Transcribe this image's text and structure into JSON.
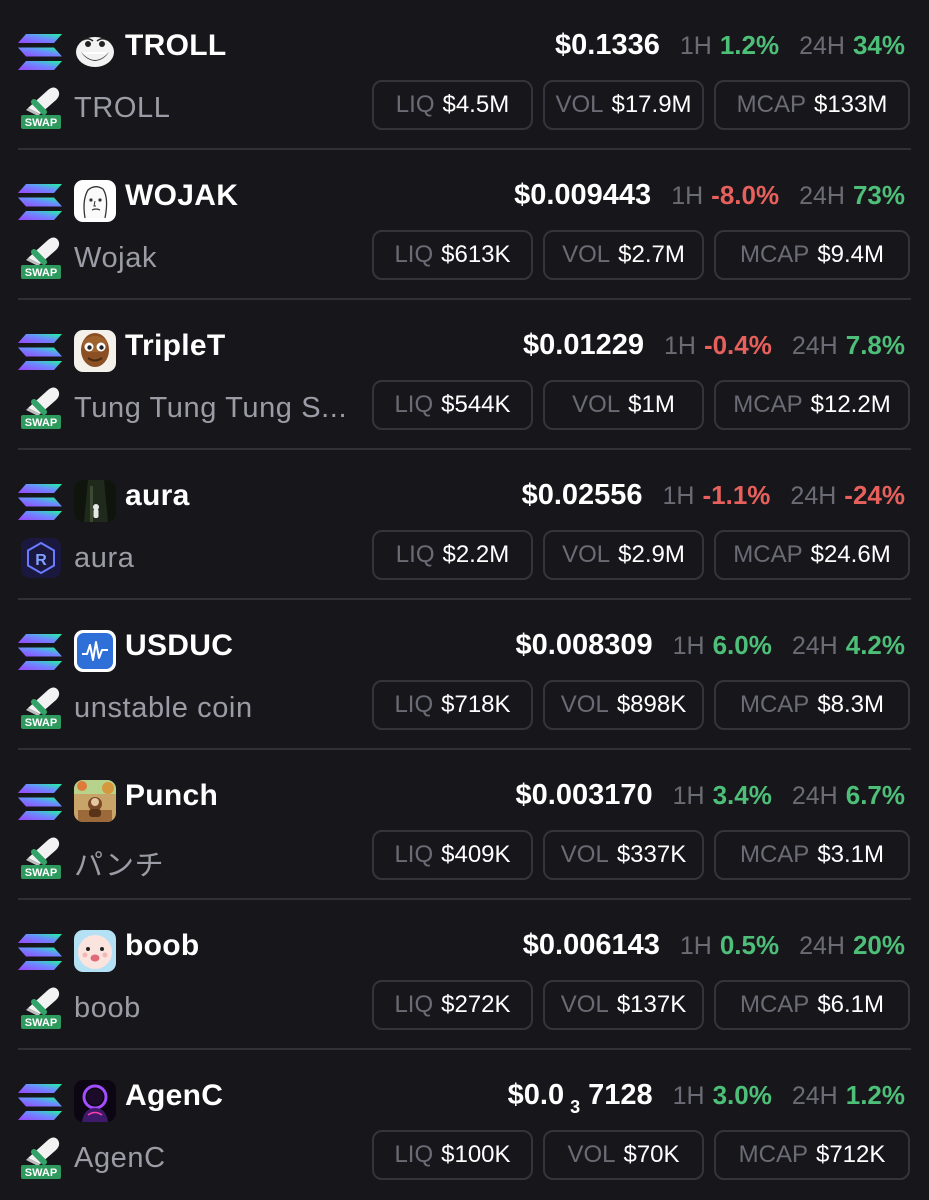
{
  "tokens": [
    {
      "symbol": "TROLL",
      "name": "TROLL",
      "logo": "troll-face-logo",
      "dex": "swap",
      "chain": "solana",
      "price": "$0.1336",
      "price_sub": "",
      "price_tail": "",
      "h1_label": "1H",
      "h1": "1.2%",
      "h1_dir": "pos",
      "h24_label": "24H",
      "h24": "34%",
      "h24_dir": "pos",
      "liq_label": "LIQ",
      "liq": "$4.5M",
      "vol_label": "VOL",
      "vol": "$17.9M",
      "mcap_label": "MCAP",
      "mcap": "$133M"
    },
    {
      "symbol": "WOJAK",
      "name": "Wojak",
      "logo": "wojak-logo",
      "dex": "swap",
      "chain": "solana",
      "price": "$0.009443",
      "price_sub": "",
      "price_tail": "",
      "h1_label": "1H",
      "h1": "-8.0%",
      "h1_dir": "neg",
      "h24_label": "24H",
      "h24": "73%",
      "h24_dir": "pos",
      "liq_label": "LIQ",
      "liq": "$613K",
      "vol_label": "VOL",
      "vol": "$2.7M",
      "mcap_label": "MCAP",
      "mcap": "$9.4M"
    },
    {
      "symbol": "TripleT",
      "name": "Tung Tung Tung S...",
      "logo": "tripleT-logo",
      "dex": "swap",
      "chain": "solana",
      "price": "$0.01229",
      "price_sub": "",
      "price_tail": "",
      "h1_label": "1H",
      "h1": "-0.4%",
      "h1_dir": "neg",
      "h24_label": "24H",
      "h24": "7.8%",
      "h24_dir": "pos",
      "liq_label": "LIQ",
      "liq": "$544K",
      "vol_label": "VOL",
      "vol": "$1M",
      "mcap_label": "MCAP",
      "mcap": "$12.2M"
    },
    {
      "symbol": "aura",
      "name": "aura",
      "logo": "aura-logo",
      "dex": "raydium",
      "chain": "solana",
      "price": "$0.02556",
      "price_sub": "",
      "price_tail": "",
      "h1_label": "1H",
      "h1": "-1.1%",
      "h1_dir": "neg",
      "h24_label": "24H",
      "h24": "-24%",
      "h24_dir": "neg",
      "liq_label": "LIQ",
      "liq": "$2.2M",
      "vol_label": "VOL",
      "vol": "$2.9M",
      "mcap_label": "MCAP",
      "mcap": "$24.6M"
    },
    {
      "symbol": "USDUC",
      "name": "unstable coin",
      "logo": "usduc-logo",
      "dex": "swap",
      "chain": "solana",
      "price": "$0.008309",
      "price_sub": "",
      "price_tail": "",
      "h1_label": "1H",
      "h1": "6.0%",
      "h1_dir": "pos",
      "h24_label": "24H",
      "h24": "4.2%",
      "h24_dir": "pos",
      "liq_label": "LIQ",
      "liq": "$718K",
      "vol_label": "VOL",
      "vol": "$898K",
      "mcap_label": "MCAP",
      "mcap": "$8.3M"
    },
    {
      "symbol": "Punch",
      "name": "パンチ",
      "logo": "punch-logo",
      "dex": "swap",
      "chain": "solana",
      "price": "$0.003170",
      "price_sub": "",
      "price_tail": "",
      "h1_label": "1H",
      "h1": "3.4%",
      "h1_dir": "pos",
      "h24_label": "24H",
      "h24": "6.7%",
      "h24_dir": "pos",
      "liq_label": "LIQ",
      "liq": "$409K",
      "vol_label": "VOL",
      "vol": "$337K",
      "mcap_label": "MCAP",
      "mcap": "$3.1M"
    },
    {
      "symbol": "boob",
      "name": "boob",
      "logo": "boob-logo",
      "dex": "swap",
      "chain": "solana",
      "price": "$0.006143",
      "price_sub": "",
      "price_tail": "",
      "h1_label": "1H",
      "h1": "0.5%",
      "h1_dir": "pos",
      "h24_label": "24H",
      "h24": "20%",
      "h24_dir": "pos",
      "liq_label": "LIQ",
      "liq": "$272K",
      "vol_label": "VOL",
      "vol": "$137K",
      "mcap_label": "MCAP",
      "mcap": "$6.1M"
    },
    {
      "symbol": "AgenC",
      "name": "AgenC",
      "logo": "agenc-logo",
      "dex": "swap",
      "chain": "solana",
      "price": "$0.0",
      "price_sub": "3",
      "price_tail": "7128",
      "h1_label": "1H",
      "h1": "3.0%",
      "h1_dir": "pos",
      "h24_label": "24H",
      "h24": "1.2%",
      "h24_dir": "pos",
      "liq_label": "LIQ",
      "liq": "$100K",
      "vol_label": "VOL",
      "vol": "$70K",
      "mcap_label": "MCAP",
      "mcap": "$712K"
    }
  ]
}
